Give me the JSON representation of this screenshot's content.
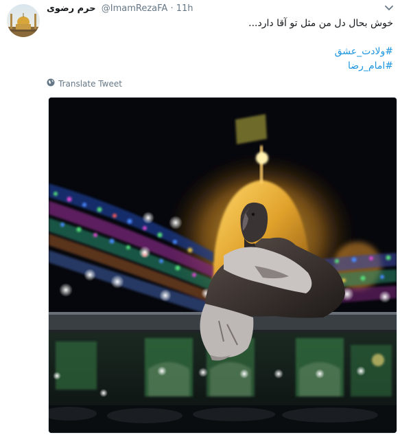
{
  "tweet": {
    "display_name": "حرم رضوی",
    "handle": "@ImamRezaFA",
    "separator": "·",
    "time": "11h",
    "text": "خوش بحال دل من مثل تو آقا دارد...",
    "hashtags": [
      "#ولادت_عشق",
      "#امام_رضا"
    ],
    "translate_label": "Translate Tweet"
  },
  "icons": {
    "caret": "chevron-down-icon",
    "translate": "globe-icon"
  },
  "colors": {
    "link": "#1b95e0",
    "secondary_text": "#657786",
    "primary_text": "#14171a",
    "border": "#e1e8ed"
  }
}
